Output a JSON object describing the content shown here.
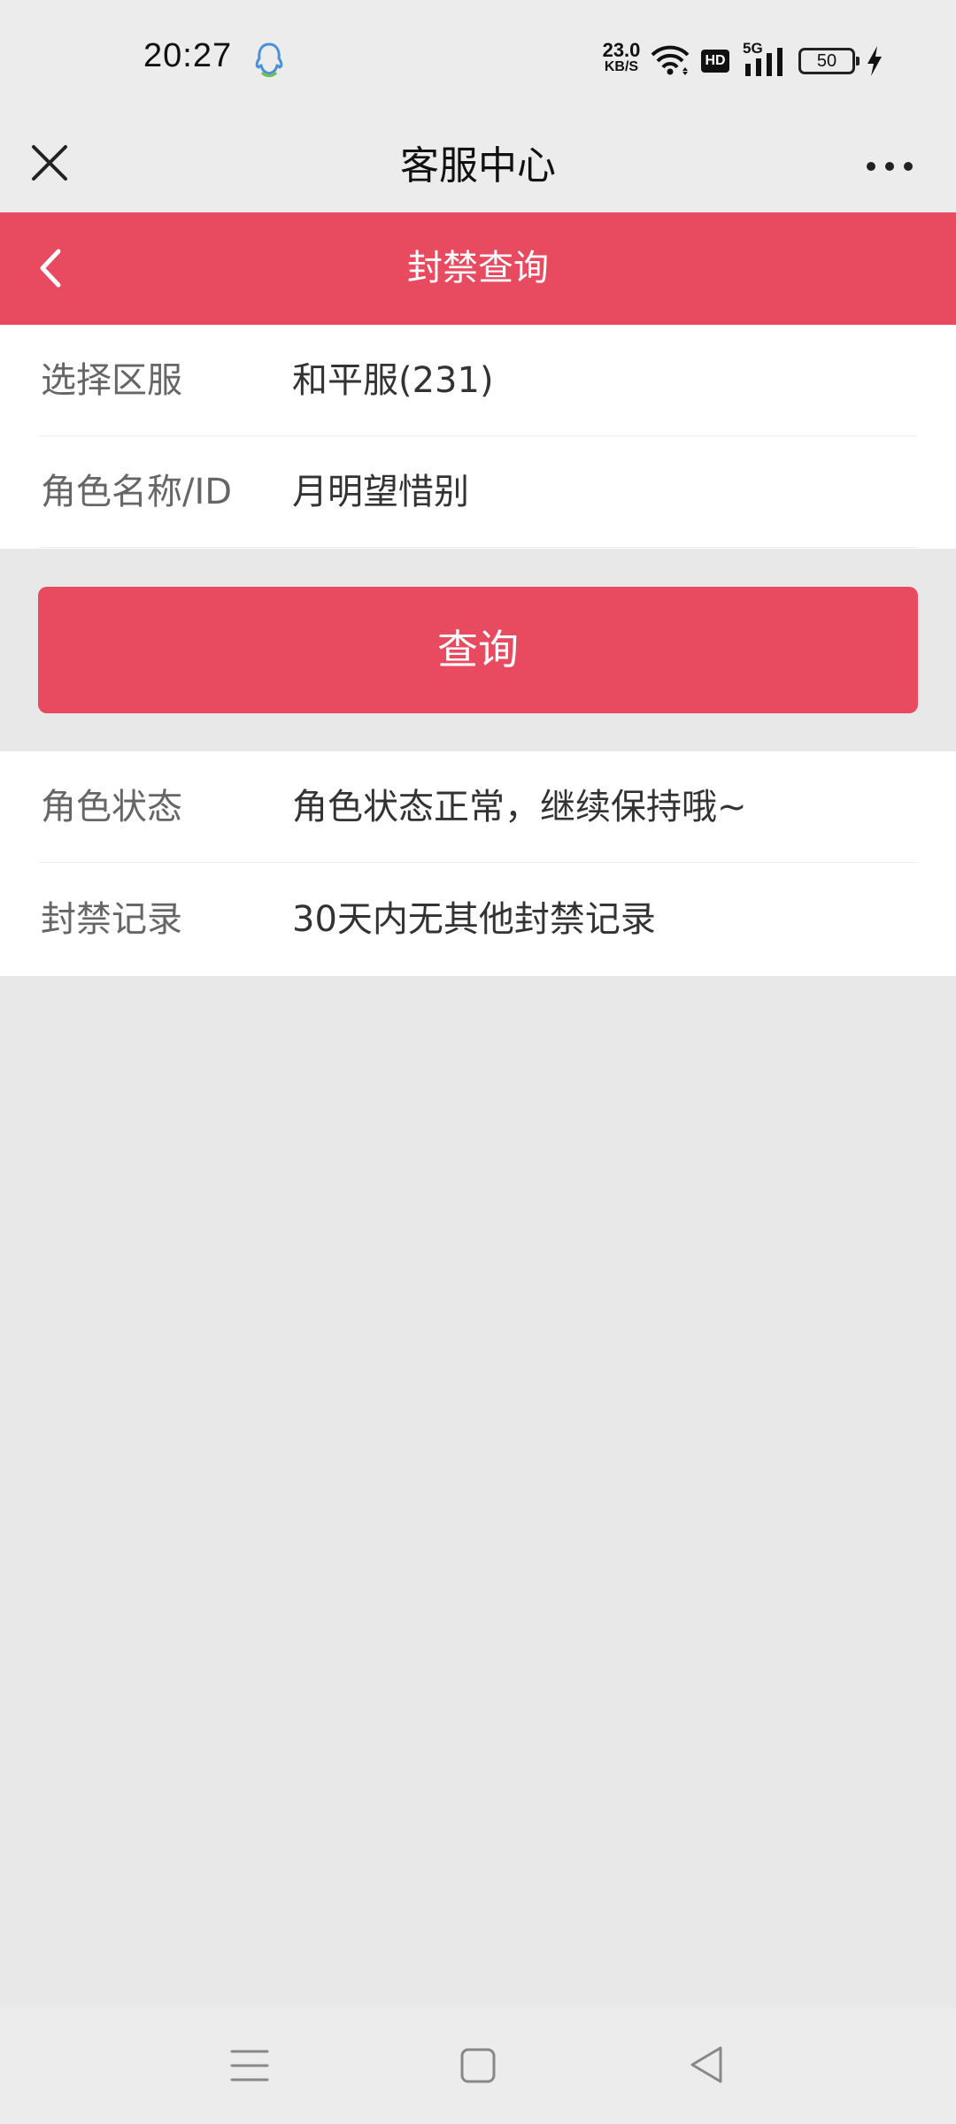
{
  "status_bar": {
    "time": "20:27",
    "speed_value": "23.0",
    "speed_unit": "KB/S",
    "hd": "HD",
    "network": "5G",
    "battery": "50"
  },
  "top_nav": {
    "title": "客服中心"
  },
  "header": {
    "title": "封禁查询"
  },
  "form": {
    "server_label": "选择区服",
    "server_value": "和平服(231)",
    "role_label": "角色名称/ID",
    "role_value": "月明望惜别"
  },
  "query_button": "查询",
  "result": {
    "status_label": "角色状态",
    "status_value": "角色状态正常，继续保持哦~",
    "record_label": "封禁记录",
    "record_value": "30天内无其他封禁记录"
  },
  "colors": {
    "accent": "#e84a5f",
    "background": "#e8e8e8"
  }
}
